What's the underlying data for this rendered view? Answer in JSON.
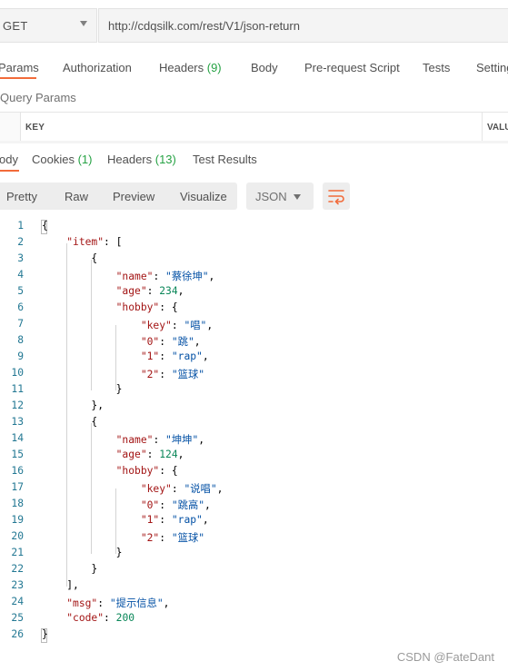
{
  "request": {
    "method": "GET",
    "url": "http://cdqsilk.com/rest/V1/json-return"
  },
  "request_tabs": [
    {
      "label": "Params",
      "count": ""
    },
    {
      "label": "Authorization",
      "count": ""
    },
    {
      "label": "Headers ",
      "count": "(9)"
    },
    {
      "label": "Body",
      "count": ""
    },
    {
      "label": "Pre-request Script",
      "count": ""
    },
    {
      "label": "Tests",
      "count": ""
    },
    {
      "label": "Setting",
      "count": ""
    }
  ],
  "query_params": {
    "title": "Query Params",
    "key_header": "KEY",
    "value_header": "VALU"
  },
  "response_tabs": [
    {
      "label": "ody",
      "count": ""
    },
    {
      "label": "Cookies ",
      "count": "(1)"
    },
    {
      "label": "Headers ",
      "count": "(13)"
    },
    {
      "label": "Test Results",
      "count": ""
    }
  ],
  "view_buttons": [
    "Pretty",
    "Raw",
    "Preview",
    "Visualize"
  ],
  "format": "JSON",
  "code_lines": [
    "{",
    "    \"item\": [",
    "        {",
    "            \"name\": \"蔡徐坤\",",
    "            \"age\": 234,",
    "            \"hobby\": {",
    "                \"key\": \"唱\",",
    "                \"0\": \"跳\",",
    "                \"1\": \"rap\",",
    "                \"2\": \"篮球\"",
    "            }",
    "        },",
    "        {",
    "            \"name\": \"坤坤\",",
    "            \"age\": 124,",
    "            \"hobby\": {",
    "                \"key\": \"说唱\",",
    "                \"0\": \"跳高\",",
    "                \"1\": \"rap\",",
    "                \"2\": \"篮球\"",
    "            }",
    "        }",
    "    ],",
    "    \"msg\": \"提示信息\",",
    "    \"code\": 200",
    "}"
  ],
  "watermark": "CSDN @FateDant",
  "colors": {
    "accent": "#f26b3a",
    "count": "#26a244",
    "json_key": "#a31515",
    "json_string": "#0451a5",
    "json_number": "#098658",
    "line_number": "#237893"
  }
}
